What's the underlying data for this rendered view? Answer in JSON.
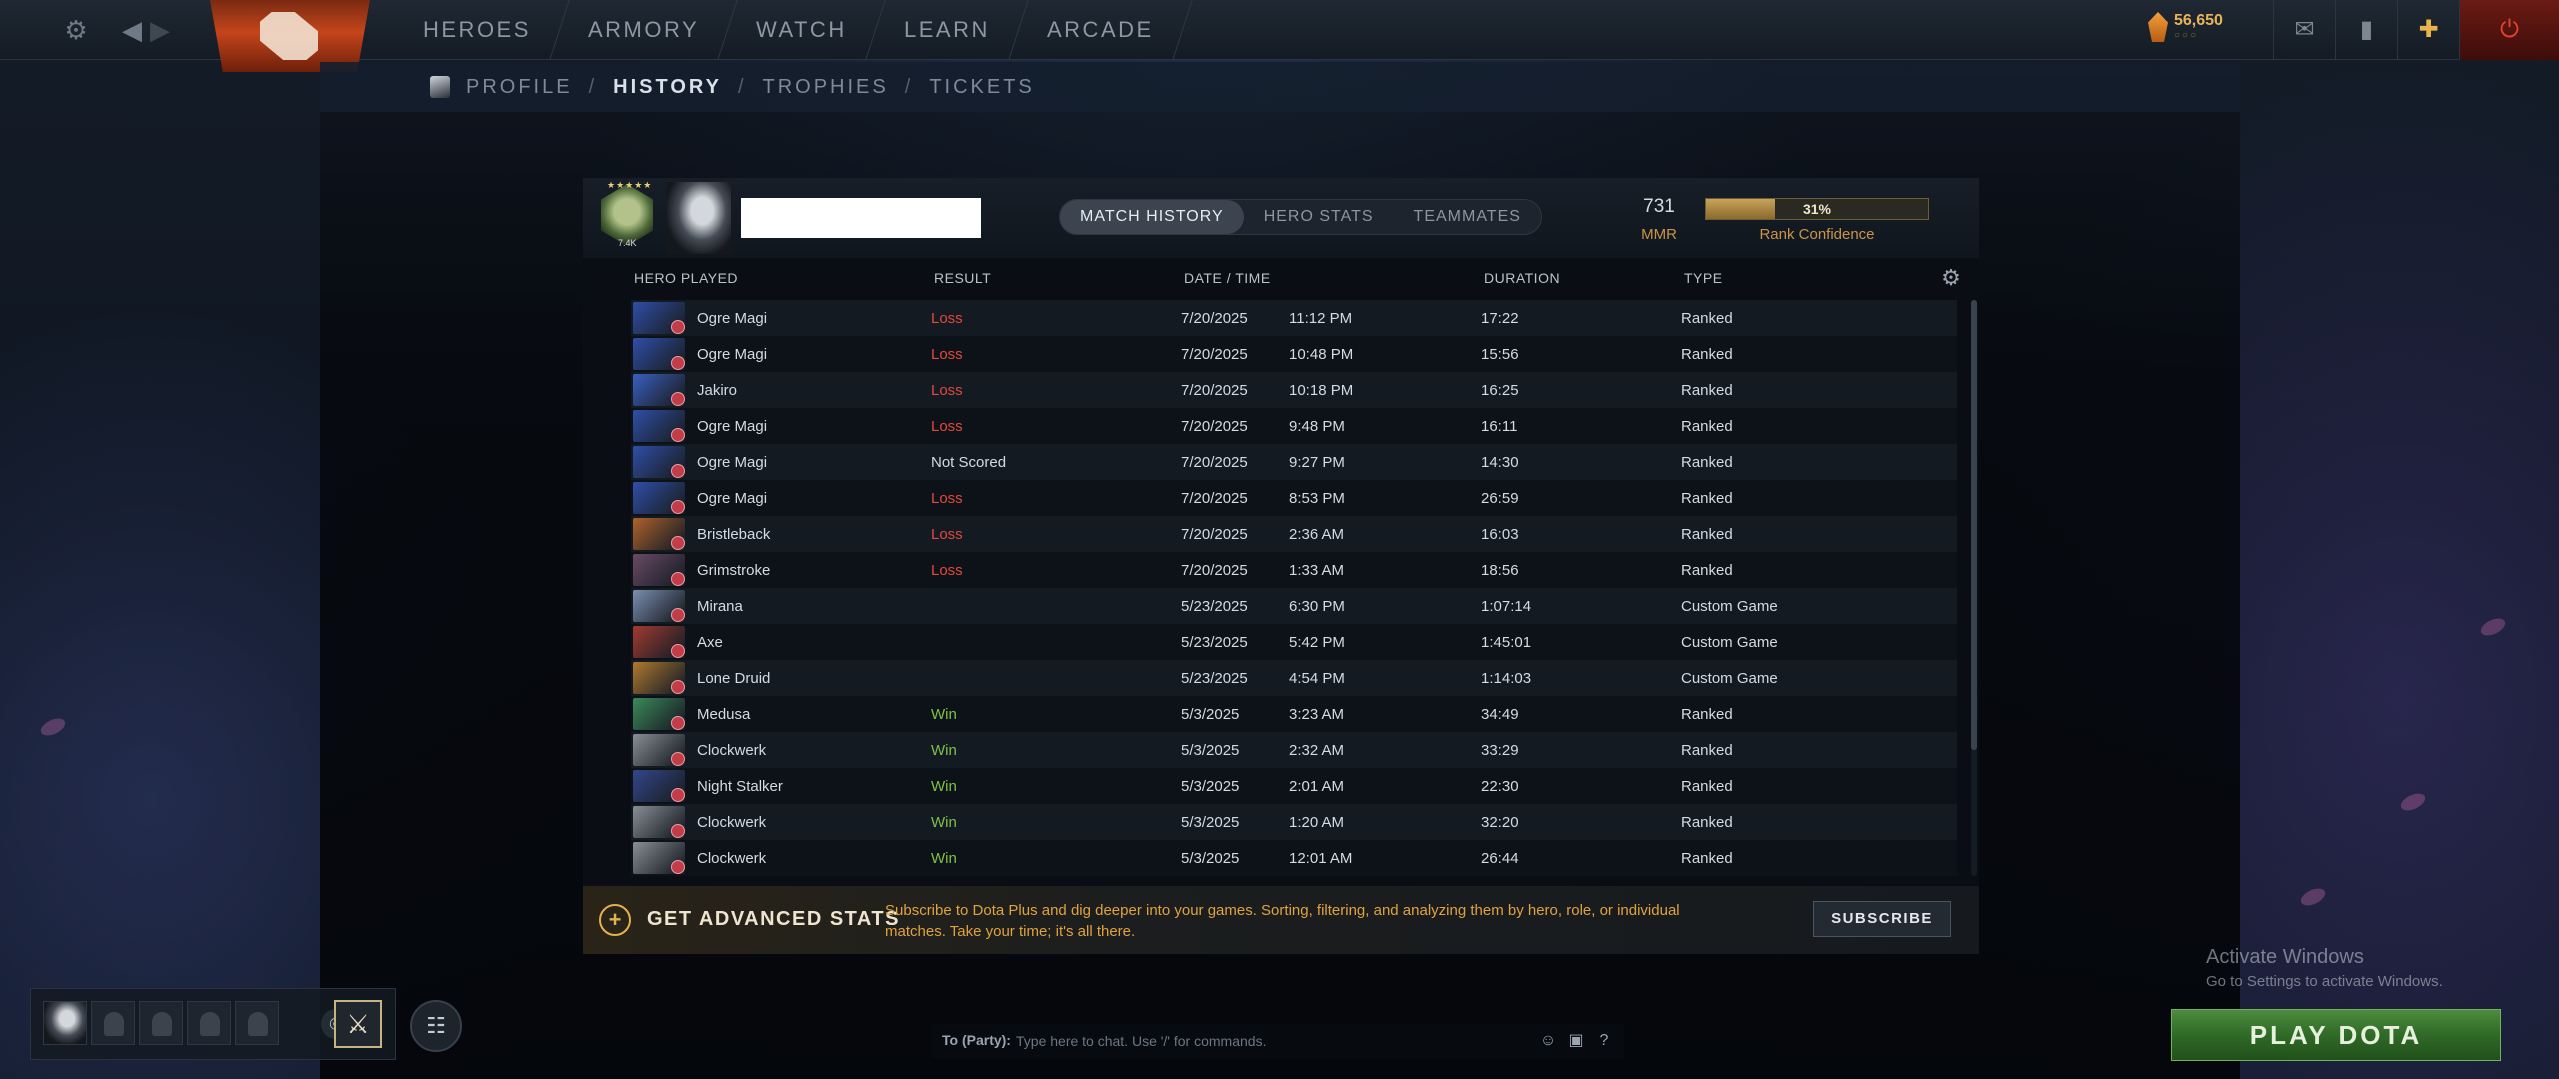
{
  "topbar": {
    "nav": [
      "HEROES",
      "ARMORY",
      "WATCH",
      "LEARN",
      "ARCADE"
    ],
    "currency_value": "56,650",
    "currency_dots": "○○○"
  },
  "subnav": {
    "items": [
      "PROFILE",
      "HISTORY",
      "TROPHIES",
      "TICKETS"
    ],
    "active": "HISTORY",
    "separator": "/"
  },
  "profile": {
    "rank_number": "7.4K",
    "rank_stars": "★★★★★",
    "mmr_value": "731",
    "mmr_label": "MMR",
    "rank_confidence_percent": 31,
    "rank_confidence_text": "31%",
    "rank_confidence_label": "Rank Confidence"
  },
  "tabs": [
    "MATCH HISTORY",
    "HERO STATS",
    "TEAMMATES"
  ],
  "active_tab": "MATCH HISTORY",
  "columns": {
    "hero": "HERO PLAYED",
    "result": "RESULT",
    "datetime": "DATE / TIME",
    "duration": "DURATION",
    "type": "TYPE"
  },
  "matches": [
    {
      "hero": "Ogre Magi",
      "result": "Loss",
      "date": "7/20/2025",
      "time": "11:12 PM",
      "duration": "17:22",
      "type": "Ranked",
      "color": "#2f4fa8"
    },
    {
      "hero": "Ogre Magi",
      "result": "Loss",
      "date": "7/20/2025",
      "time": "10:48 PM",
      "duration": "15:56",
      "type": "Ranked",
      "color": "#2f4fa8"
    },
    {
      "hero": "Jakiro",
      "result": "Loss",
      "date": "7/20/2025",
      "time": "10:18 PM",
      "duration": "16:25",
      "type": "Ranked",
      "color": "#3a5fc0"
    },
    {
      "hero": "Ogre Magi",
      "result": "Loss",
      "date": "7/20/2025",
      "time": "9:48 PM",
      "duration": "16:11",
      "type": "Ranked",
      "color": "#2f4fa8"
    },
    {
      "hero": "Ogre Magi",
      "result": "Not Scored",
      "date": "7/20/2025",
      "time": "9:27 PM",
      "duration": "14:30",
      "type": "Ranked",
      "color": "#2f4fa8"
    },
    {
      "hero": "Ogre Magi",
      "result": "Loss",
      "date": "7/20/2025",
      "time": "8:53 PM",
      "duration": "26:59",
      "type": "Ranked",
      "color": "#2f4fa8"
    },
    {
      "hero": "Bristleback",
      "result": "Loss",
      "date": "7/20/2025",
      "time": "2:36 AM",
      "duration": "16:03",
      "type": "Ranked",
      "color": "#b0622a"
    },
    {
      "hero": "Grimstroke",
      "result": "Loss",
      "date": "7/20/2025",
      "time": "1:33 AM",
      "duration": "18:56",
      "type": "Ranked",
      "color": "#6a4a64"
    },
    {
      "hero": "Mirana",
      "result": "",
      "date": "5/23/2025",
      "time": "6:30 PM",
      "duration": "1:07:14",
      "type": "Custom Game",
      "color": "#7b8fb0"
    },
    {
      "hero": "Axe",
      "result": "",
      "date": "5/23/2025",
      "time": "5:42 PM",
      "duration": "1:45:01",
      "type": "Custom Game",
      "color": "#a33a30"
    },
    {
      "hero": "Lone Druid",
      "result": "",
      "date": "5/23/2025",
      "time": "4:54 PM",
      "duration": "1:14:03",
      "type": "Custom Game",
      "color": "#b07a2e"
    },
    {
      "hero": "Medusa",
      "result": "Win",
      "date": "5/3/2025",
      "time": "3:23 AM",
      "duration": "34:49",
      "type": "Ranked",
      "color": "#3c8a5a"
    },
    {
      "hero": "Clockwerk",
      "result": "Win",
      "date": "5/3/2025",
      "time": "2:32 AM",
      "duration": "33:29",
      "type": "Ranked",
      "color": "#8a8f96"
    },
    {
      "hero": "Night Stalker",
      "result": "Win",
      "date": "5/3/2025",
      "time": "2:01 AM",
      "duration": "22:30",
      "type": "Ranked",
      "color": "#33478a"
    },
    {
      "hero": "Clockwerk",
      "result": "Win",
      "date": "5/3/2025",
      "time": "1:20 AM",
      "duration": "32:20",
      "type": "Ranked",
      "color": "#8a8f96"
    },
    {
      "hero": "Clockwerk",
      "result": "Win",
      "date": "5/3/2025",
      "time": "12:01 AM",
      "duration": "26:44",
      "type": "Ranked",
      "color": "#8a8f96"
    }
  ],
  "promo": {
    "title": "GET ADVANCED STATS",
    "description": "Subscribe to Dota Plus and dig deeper into your games. Sorting, filtering, and analyzing them by hero, role, or individual matches. Take your time; it's all there.",
    "button": "SUBSCRIBE"
  },
  "chat": {
    "label": "To (Party):",
    "placeholder": "Type here to chat. Use '/' for commands."
  },
  "windows_notice": {
    "title": "Activate Windows",
    "subtitle": "Go to Settings to activate Windows."
  },
  "play_button": "PLAY DOTA",
  "colors": {
    "loss": "#e2483d",
    "win": "#7fc048",
    "gold": "#e6b35a",
    "play": "#2f6a27"
  }
}
